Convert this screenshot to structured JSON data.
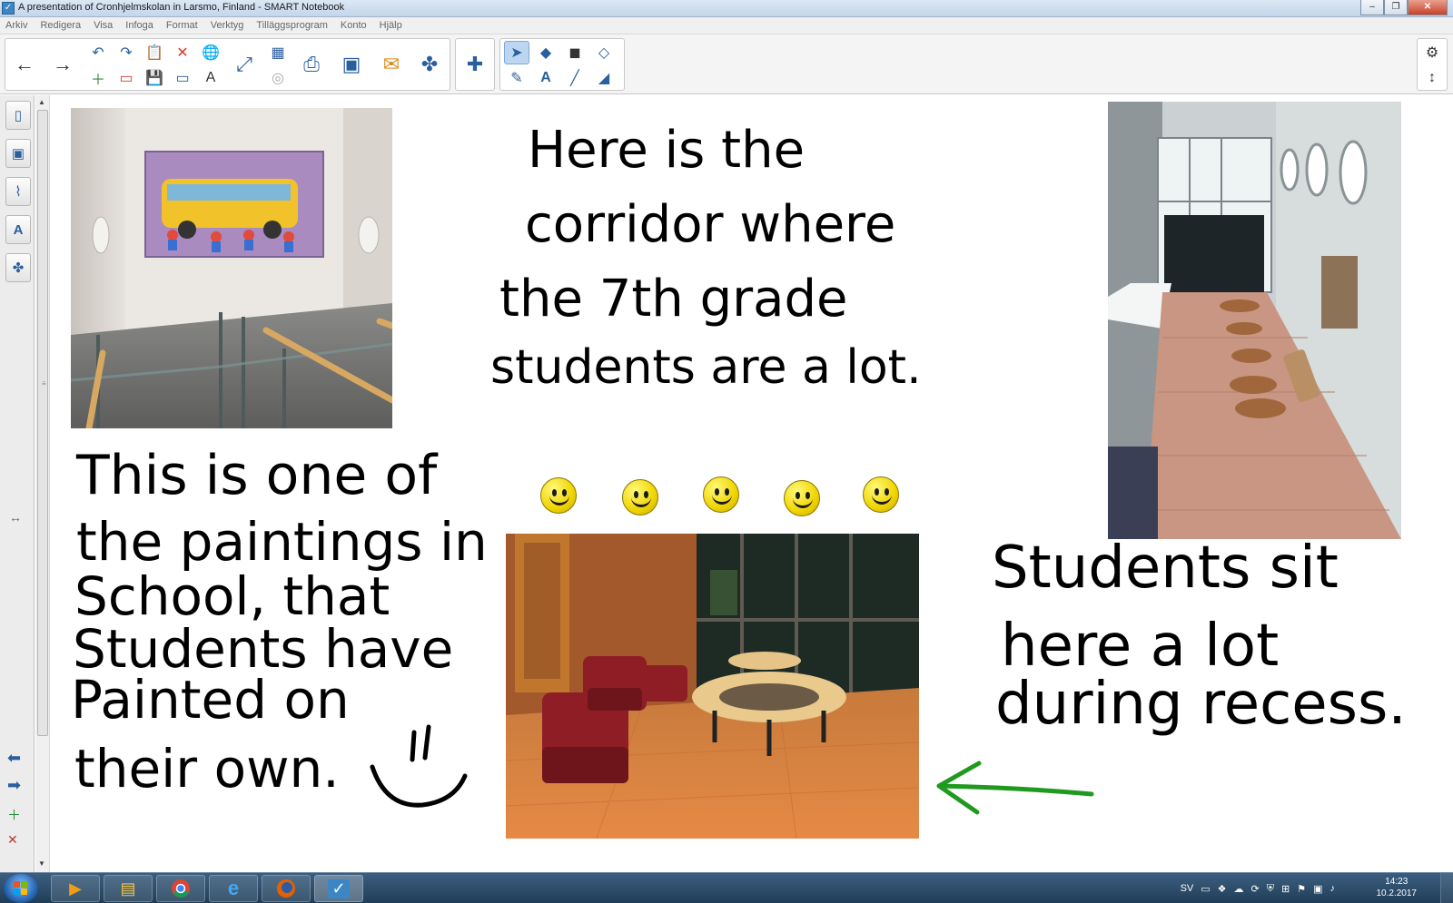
{
  "window": {
    "title": "A presentation of Cronhjelmskolan in Larsmo, Finland - SMART Notebook",
    "controls": [
      "–",
      "❐",
      "✕"
    ]
  },
  "menu": [
    "Arkiv",
    "Redigera",
    "Visa",
    "Infoga",
    "Format",
    "Verktyg",
    "Tilläggsprogram",
    "Konto",
    "Hjälp"
  ],
  "toolbar": {
    "icons": {
      "back": "←",
      "forward": "→",
      "undo": "↶",
      "redo": "↷",
      "paste": "📋",
      "delete": "✕",
      "globe": "🌐",
      "add_page": "＋",
      "delete_page": "▭",
      "save": "💾",
      "screen_shade": "▭",
      "text_format": "A",
      "fullscreen": "⤢",
      "table": "▦",
      "print": "⎙",
      "screen": "▣",
      "measure": "◎",
      "response": "✉",
      "addon": "✤",
      "puzzle": "✚",
      "select": "➤",
      "shapes": "◆",
      "eraser_shape": "◼",
      "fill": "◇",
      "pens": "✎",
      "text": "A",
      "line": "╱",
      "eraser": "◢",
      "settings": "⚙",
      "move_toolbar": "↕"
    }
  },
  "sidebar": {
    "tabs": [
      {
        "name": "page-sorter",
        "glyph": "▯"
      },
      {
        "name": "gallery",
        "glyph": "▣"
      },
      {
        "name": "attachments",
        "glyph": "⌇"
      },
      {
        "name": "properties",
        "glyph": "A"
      },
      {
        "name": "add-ons",
        "glyph": "✤"
      }
    ],
    "resize_glyph": "↔",
    "prev_page": "⬅",
    "next_page": "➡",
    "add_page": "＋",
    "delete_page": "✕"
  },
  "canvas": {
    "notes": {
      "corridor_line1": "Here is the",
      "corridor_line2": "corridor where",
      "corridor_line3": "the 7th grade",
      "corridor_line4": "students are a lot.",
      "painting_line1": "This is one of",
      "painting_line2": "the paintings in",
      "painting_line3": "School, that",
      "painting_line4": "Students have",
      "painting_line5": "Painted on",
      "painting_line6": "their own.",
      "sit_line1": "Students sit",
      "sit_line2": "here a lot",
      "sit_line3": "during recess."
    },
    "smileys": 5,
    "arrow_color": "#1f9a1f"
  },
  "taskbar": {
    "apps": [
      "media-player",
      "file-explorer",
      "chrome",
      "internet-explorer",
      "firefox",
      "smart-notebook"
    ],
    "tray": {
      "language": "SV",
      "time": "14:23",
      "date": "10.2.2017"
    }
  }
}
